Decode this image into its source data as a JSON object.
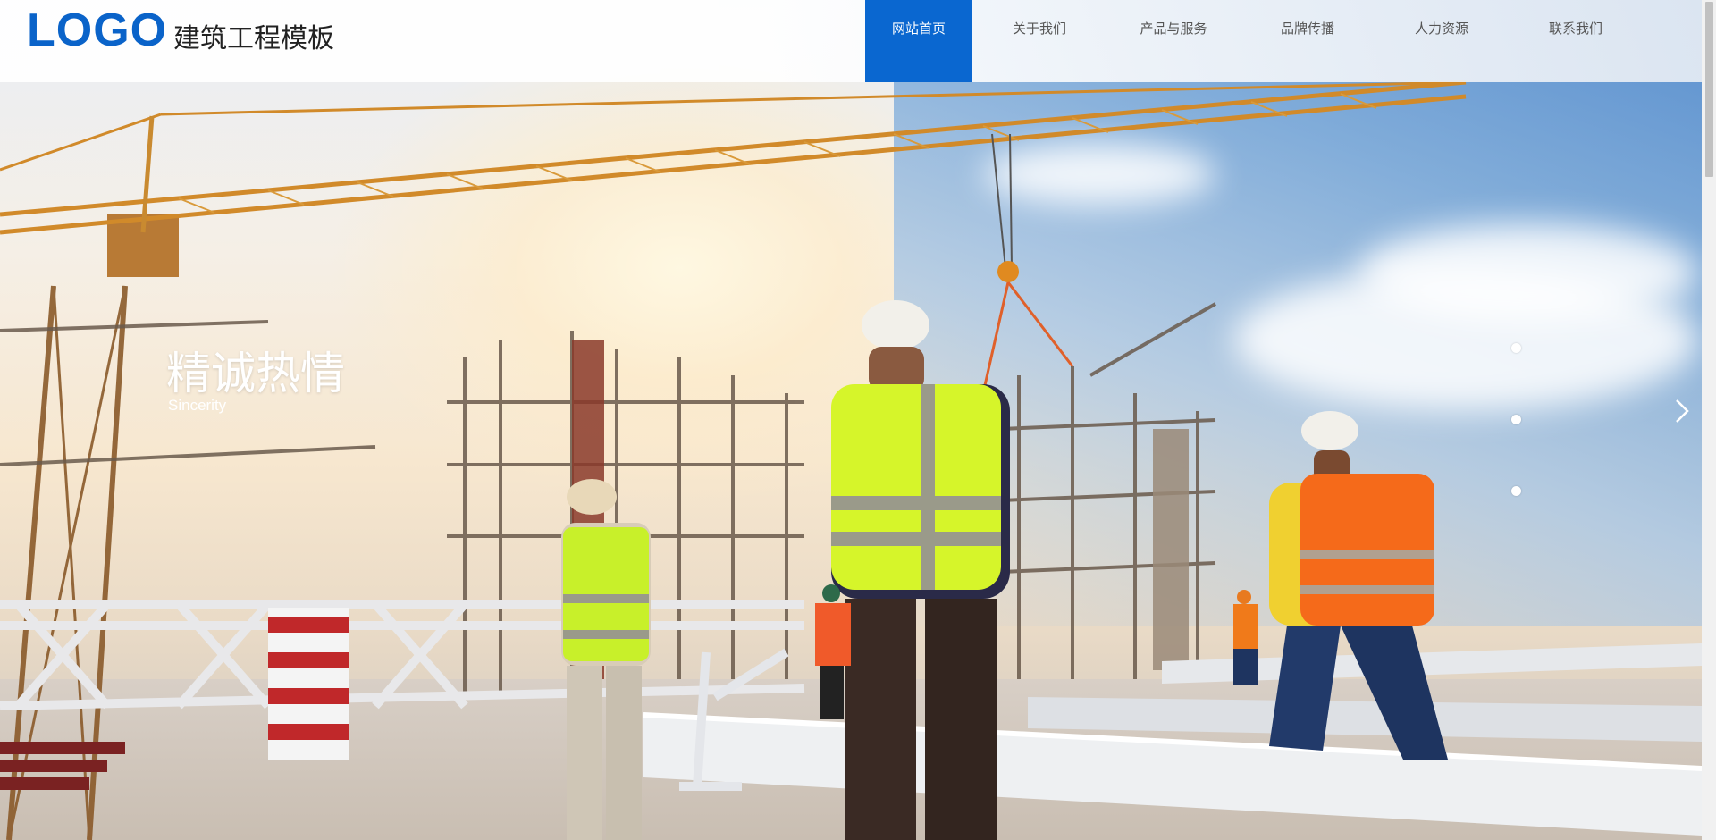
{
  "header": {
    "logo": "LOGO",
    "site_name": "建筑工程模板"
  },
  "nav": {
    "items": [
      {
        "label": "网站首页",
        "active": true
      },
      {
        "label": "关于我们",
        "active": false
      },
      {
        "label": "产品与服务",
        "active": false
      },
      {
        "label": "品牌传播",
        "active": false
      },
      {
        "label": "人力资源",
        "active": false
      },
      {
        "label": "联系我们",
        "active": false
      }
    ]
  },
  "slider": {
    "title": "精诚热情",
    "subtitle": "Sincerity",
    "dots": 3,
    "next_icon": "chevron-right-icon"
  },
  "colors": {
    "brand": "#0a67d0",
    "logo": "#0a63c9",
    "nav_text": "#555555",
    "slide_text": "#ffffff"
  }
}
